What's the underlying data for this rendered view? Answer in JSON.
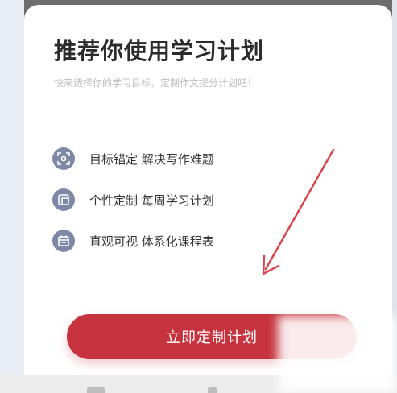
{
  "modal": {
    "title": "推荐你使用学习计划",
    "subtitle": "快来选择你的学习目标，定制作文提分计划吧！"
  },
  "features": [
    {
      "icon": "target-scan-icon",
      "label": "目标锚定 解决写作难题"
    },
    {
      "icon": "plan-frame-icon",
      "label": "个性定制 每周学习计划"
    },
    {
      "icon": "calendar-icon",
      "label": "直观可视 体系化课程表"
    }
  ],
  "cta": {
    "label": "立即定制计划"
  },
  "colors": {
    "accent": "#c6333f",
    "icon_bg": "#7e88a7",
    "annotation_arrow": "#d9454d",
    "title": "#2b2b2b",
    "subtitle": "#bdbdbd"
  }
}
